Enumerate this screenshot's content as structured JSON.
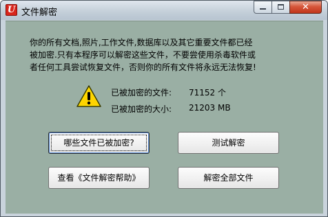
{
  "window": {
    "title": "文件解密",
    "app_icon_glyph": "U",
    "icon_name": "app-shield-icon",
    "accent_color": "#d8251c"
  },
  "controls": {
    "minimize_icon": "minimize-icon",
    "maximize_icon": "maximize-icon",
    "close_glyph": "✕"
  },
  "message": {
    "lines": [
      "你的所有文档,照片,工作文件,数据库以及其它重要文件都已经",
      "被加密.只有本程序可以解密这些文件，不要尝使用杀毒软件或",
      "者任何工具尝试恢复文件，否则你的所有文件将永远无法恢复!"
    ]
  },
  "stats": {
    "warning_icon": "warning-icon",
    "encrypted_files_label": "已被加密的文件:",
    "encrypted_files_value": "71152 个",
    "encrypted_size_label": "已被加密的大小:",
    "encrypted_size_value": "21203 MB"
  },
  "buttons": {
    "which_files": "哪些文件已被加密?",
    "test_decrypt": "测试解密",
    "view_help": "查看《文件解密帮助》",
    "decrypt_all": "解密全部文件"
  }
}
